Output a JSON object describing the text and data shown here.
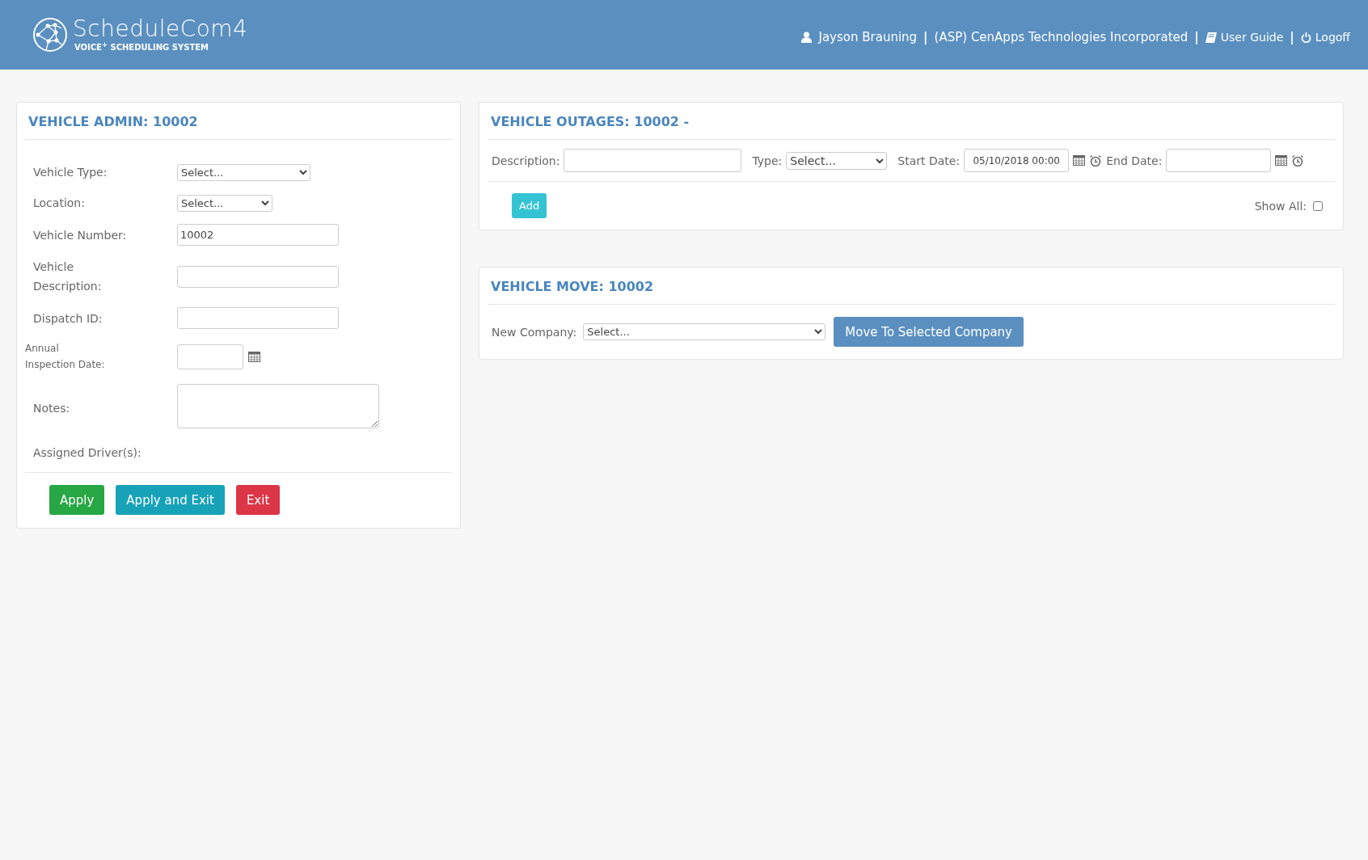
{
  "header": {
    "brand": "ScheduleCom4",
    "tagline": "VOICE",
    "tagline_sup": "+",
    "tagline_rest": "SCHEDULING SYSTEM",
    "user": "Jayson Brauning",
    "separator": "|",
    "company": "(ASP) CenApps Technologies Incorporated",
    "links": [
      {
        "kind": "guide",
        "label": "User Guide"
      },
      {
        "kind": "logoff",
        "label": "Logoff"
      }
    ]
  },
  "vehicle_admin": {
    "title": "VEHICLE ADMIN: 10002",
    "fields": [
      {
        "kind": "select",
        "label": "Vehicle Type:",
        "value": "Select..."
      },
      {
        "kind": "select",
        "label": "Location:",
        "value": "Select..."
      },
      {
        "kind": "text",
        "label": "Vehicle Number:",
        "value": "10002"
      },
      {
        "kind": "text",
        "label": "Vehicle Description:"
      },
      {
        "kind": "text",
        "label": "Dispatch ID:"
      },
      {
        "kind": "date",
        "label": "Annual Inspection Date:"
      },
      {
        "kind": "textarea",
        "label": "Notes:"
      },
      {
        "kind": "none",
        "label": "Assigned Driver(s):"
      }
    ],
    "buttons": [
      {
        "kind": "success",
        "label": "Apply"
      },
      {
        "kind": "info",
        "label": "Apply and Exit"
      },
      {
        "kind": "danger",
        "label": "Exit"
      }
    ]
  },
  "vehicle_outages": {
    "title": "VEHICLE OUTAGES: 10002 -",
    "description_label": "Description:",
    "type_label": "Type:",
    "type_value": "Select...",
    "start_label": "Start Date:",
    "start_value": "05/10/2018 00:00",
    "end_label": "End Date:",
    "add_button": "Add",
    "show_all_label": "Show All:",
    "show_all_checked": false
  },
  "vehicle_move": {
    "title": "VEHICLE MOVE: 10002",
    "company_label": "New Company:",
    "company_value": "Select...",
    "move_button": "Move To Selected Company"
  }
}
